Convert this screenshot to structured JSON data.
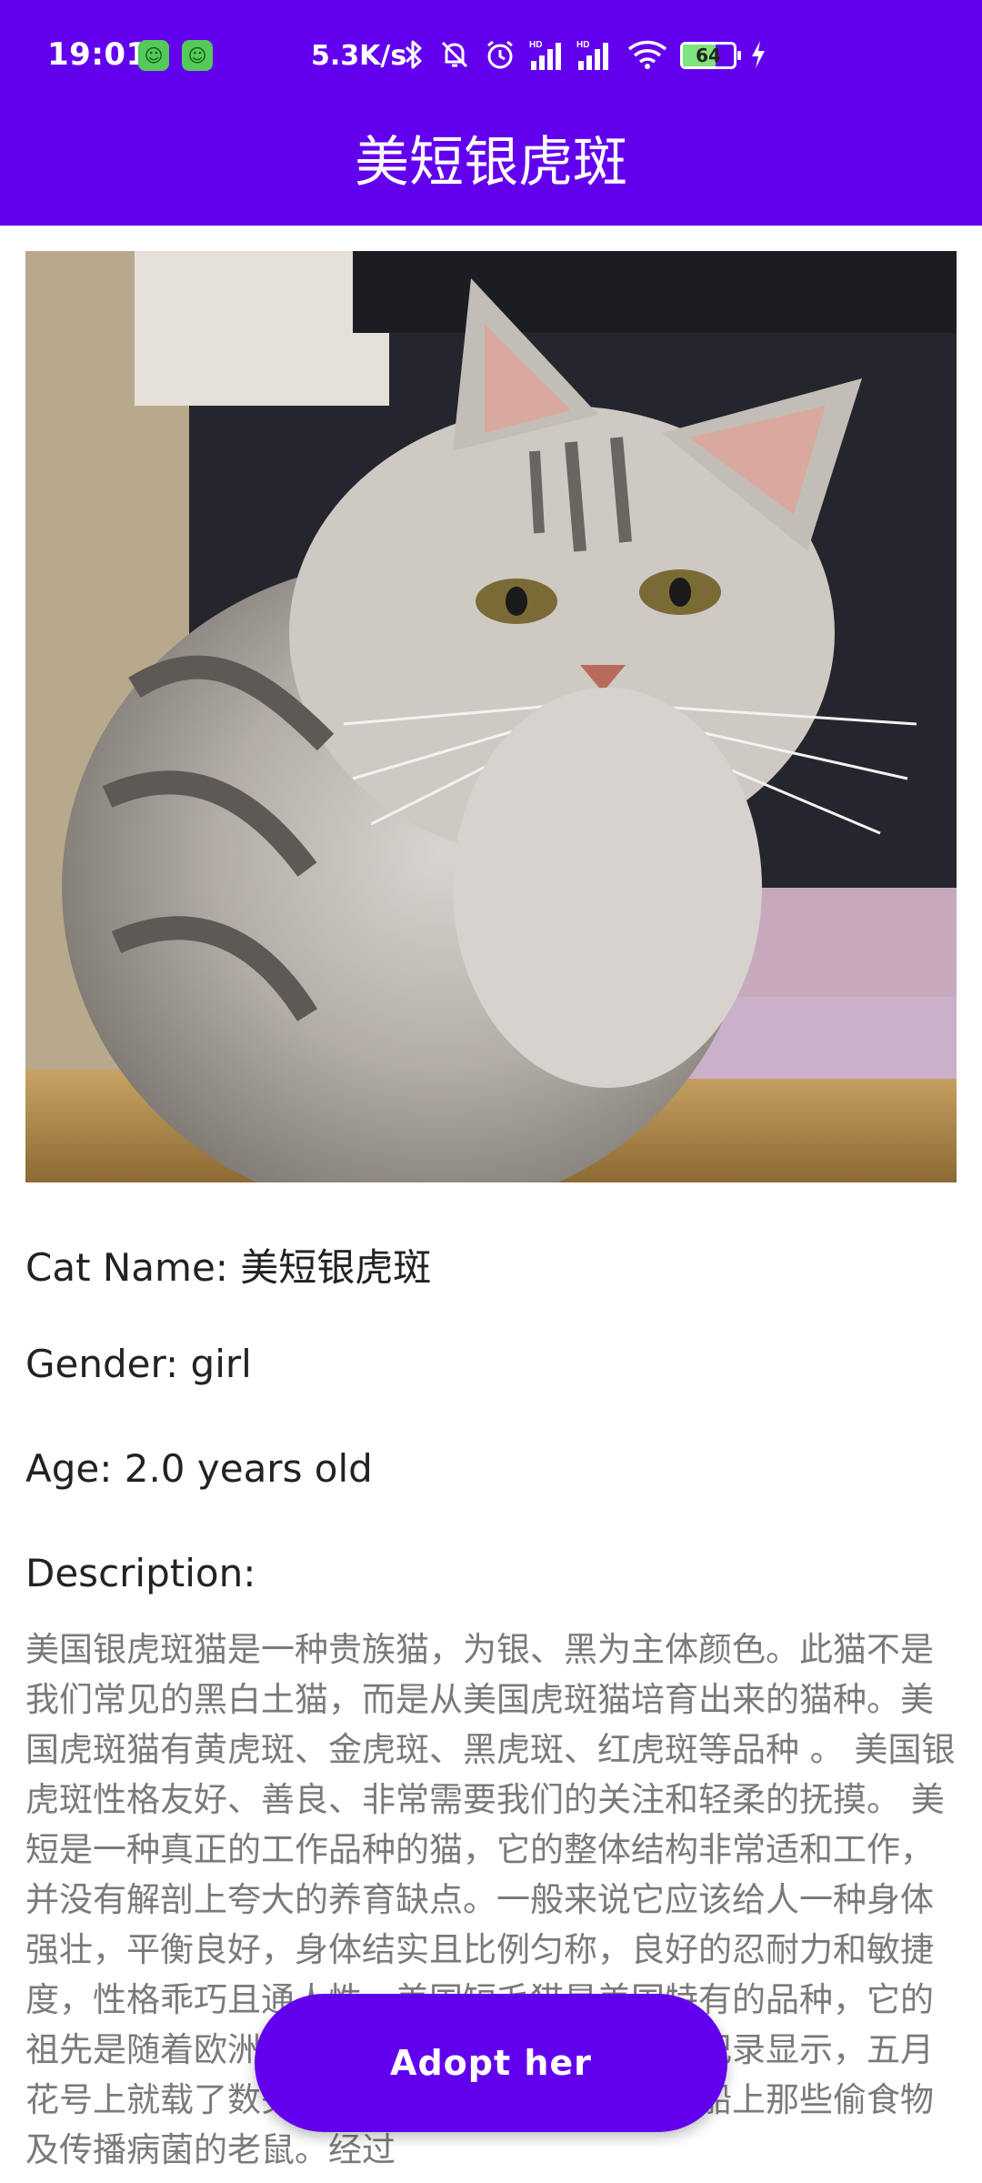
{
  "status_bar": {
    "time": "19:01",
    "net_speed": "5.3K/s",
    "battery_level": "64",
    "icons": [
      "app-notification-icon",
      "app-notification-icon",
      "bluetooth-icon",
      "mute-icon",
      "alarm-icon",
      "signal-hd-icon",
      "signal-hd-icon",
      "wifi-icon",
      "battery-icon",
      "charging-icon"
    ]
  },
  "app_bar": {
    "title": "美短银虎斑"
  },
  "cat": {
    "image_icon": "cat-photo",
    "name_line": "Cat Name: 美短银虎斑",
    "gender_line": "Gender: girl",
    "age_line": "Age: 2.0 years old",
    "description_label": "Description:",
    "description": "美国银虎斑猫是一种贵族猫，为银、黑为主体颜色。此猫不是我们常见的黑白土猫，而是从美国虎斑猫培育出来的猫种。美国虎斑猫有黄虎斑、金虎斑、黑虎斑、红虎斑等品种 。 美国银虎斑性格友好、善良、非常需要我们的关注和轻柔的抚摸。 美短是一种真正的工作品种的猫，它的整体结构非常适和工作，并没有解剖上夸大的养育缺点。一般来说它应该给人一种身体强壮，平衡良好，身体结实且比例匀称，良好的忍耐力和敏捷度，性格乖巧且通人性。美国短毛猫是美国特有的品种，它的祖先是随着欧洲早期的开拓者进入北美洲。有纪录显示，五月花号上就载了数头猫儿，它们的职责就是捕捉船上那些偷食物及传播病菌的老鼠。经过"
  },
  "actions": {
    "adopt_label": "Adopt her"
  },
  "colors": {
    "primary": "#6200EE",
    "text": "#222222",
    "description_text": "#7A7A7A"
  }
}
